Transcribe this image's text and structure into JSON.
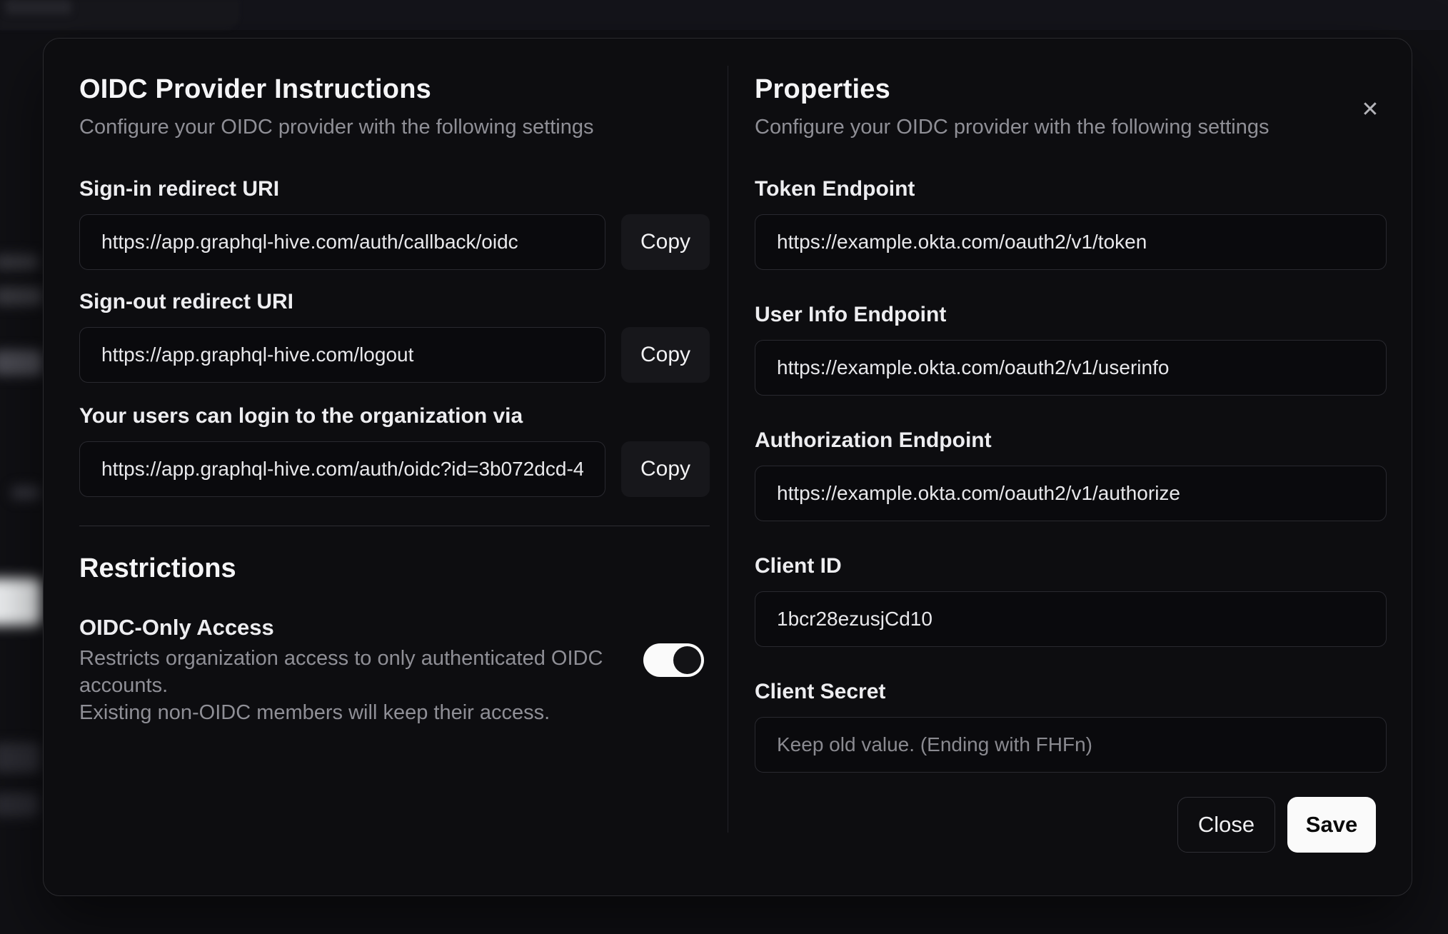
{
  "modal": {
    "close_icon": "✕",
    "left": {
      "title": "OIDC Provider Instructions",
      "subtitle": "Configure your OIDC provider with the following settings",
      "fields": [
        {
          "label": "Sign-in redirect URI",
          "value": "https://app.graphql-hive.com/auth/callback/oidc",
          "button": "Copy"
        },
        {
          "label": "Sign-out redirect URI",
          "value": "https://app.graphql-hive.com/logout",
          "button": "Copy"
        },
        {
          "label": "Your users can login to the organization via",
          "value": "https://app.graphql-hive.com/auth/oidc?id=3b072dcd-4",
          "button": "Copy"
        }
      ],
      "restrictions": {
        "title": "Restrictions",
        "toggle_label": "OIDC-Only Access",
        "toggle_description_line1": "Restricts organization access to only authenticated OIDC accounts.",
        "toggle_description_line2": "Existing non-OIDC members will keep their access.",
        "toggle_state": "on"
      }
    },
    "right": {
      "title": "Properties",
      "subtitle": "Configure your OIDC provider with the following settings",
      "fields": [
        {
          "label": "Token Endpoint",
          "value": "https://example.okta.com/oauth2/v1/token"
        },
        {
          "label": "User Info Endpoint",
          "value": "https://example.okta.com/oauth2/v1/userinfo"
        },
        {
          "label": "Authorization Endpoint",
          "value": "https://example.okta.com/oauth2/v1/authorize"
        },
        {
          "label": "Client ID",
          "value": "1bcr28ezusjCd10"
        },
        {
          "label": "Client Secret",
          "value": "",
          "placeholder": "Keep old value. (Ending with FHFn)"
        }
      ],
      "buttons": {
        "close": "Close",
        "save": "Save"
      }
    }
  },
  "colors": {
    "modal_background": "#0d0d10",
    "page_backdrop": "#101014",
    "save_button": "#fafafa",
    "toggle_on_track": "#fafafa",
    "toggle_knob": "#131316"
  }
}
